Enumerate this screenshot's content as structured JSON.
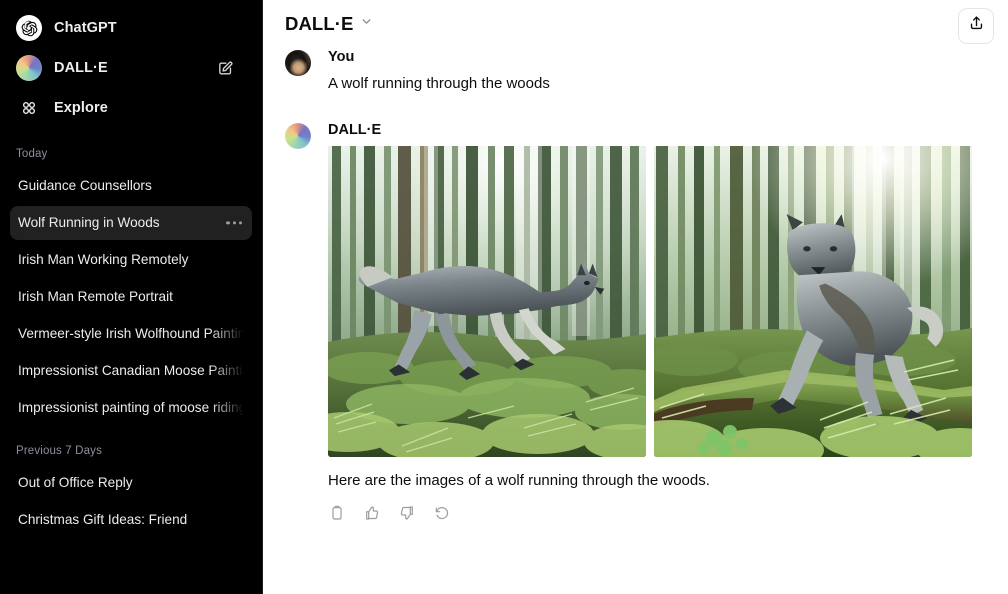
{
  "sidebar": {
    "nav": [
      {
        "label": "ChatGPT",
        "icon": "openai-logo-icon"
      },
      {
        "label": "DALL·E",
        "icon": "dalle-logo-icon"
      },
      {
        "label": "Explore",
        "icon": "explore-grid-icon"
      }
    ],
    "new_chat_icon": "new-chat-pencil-icon",
    "groups": [
      {
        "label": "Today",
        "items": [
          {
            "title": "Guidance Counsellors",
            "active": false
          },
          {
            "title": "Wolf Running in Woods",
            "active": true
          },
          {
            "title": "Irish Man Working Remotely",
            "active": false
          },
          {
            "title": "Irish Man Remote Portrait",
            "active": false
          },
          {
            "title": "Vermeer-style Irish Wolfhound Painting",
            "active": false
          },
          {
            "title": "Impressionist Canadian Moose Painting",
            "active": false
          },
          {
            "title": "Impressionist painting of moose riding",
            "active": false
          }
        ]
      },
      {
        "label": "Previous 7 Days",
        "items": [
          {
            "title": "Out of Office Reply",
            "active": false
          },
          {
            "title": "Christmas Gift Ideas: Friend",
            "active": false
          }
        ]
      }
    ]
  },
  "header": {
    "model": "DALL·E",
    "chevron_icon": "chevron-down-icon",
    "share_icon": "share-upload-icon"
  },
  "conversation": {
    "user": {
      "author": "You",
      "text": "A wolf running through the woods",
      "avatar": "user-photo-avatar"
    },
    "assistant": {
      "author": "DALL·E",
      "avatar": "dalle-logo-icon",
      "caption": "Here are the images of a wolf running through the woods.",
      "images": [
        {
          "alt": "Gray wolf running through a sunlit coniferous forest over mossy ferns"
        },
        {
          "alt": "Gray wolf leaping over a mossy fallen log in a sunlit forest"
        }
      ],
      "actions": [
        {
          "name": "copy-icon",
          "label": "Copy"
        },
        {
          "name": "thumbs-up-icon",
          "label": "Good response"
        },
        {
          "name": "thumbs-down-icon",
          "label": "Bad response"
        },
        {
          "name": "regenerate-icon",
          "label": "Regenerate"
        }
      ]
    }
  },
  "colors": {
    "sidebar_bg": "#000000",
    "sidebar_active": "#212121",
    "main_bg": "#ffffff",
    "text_primary": "#0d0d0d",
    "text_muted": "#8e8ea0",
    "icon_muted": "#9b9ba4"
  }
}
